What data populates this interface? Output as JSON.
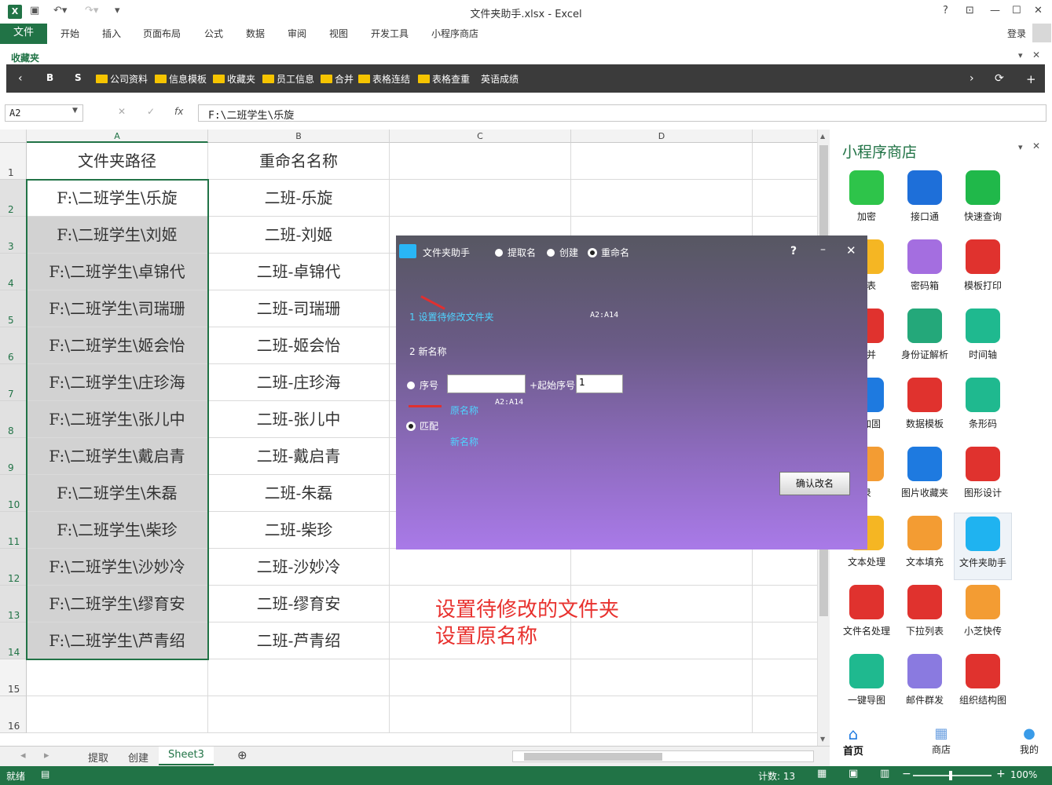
{
  "window": {
    "title": "文件夹助手.xlsx - Excel",
    "help": "?"
  },
  "ribbon": {
    "file_tab": "文件",
    "tabs": [
      "开始",
      "插入",
      "页面布局",
      "公式",
      "数据",
      "审阅",
      "视图",
      "开发工具",
      "小程序商店"
    ],
    "login": "登录"
  },
  "favorites": {
    "header": "收藏夹",
    "b_label": "B",
    "s_label": "S",
    "items": [
      "公司资料",
      "信息模板",
      "收藏夹",
      "员工信息",
      "合并",
      "表格连结",
      "表格查重",
      "英语成绩"
    ]
  },
  "formula_bar": {
    "name_box": "A2",
    "value": "F:\\二班学生\\乐旋"
  },
  "sheet": {
    "columns": [
      "A",
      "B",
      "C",
      "D"
    ],
    "rows": [
      "1",
      "2",
      "3",
      "4",
      "5",
      "6",
      "7",
      "8",
      "9",
      "10",
      "11",
      "12",
      "13",
      "14",
      "15",
      "16"
    ],
    "header_a": "文件夹路径",
    "header_b": "重命名名称",
    "col_a": [
      "F:\\二班学生\\乐旋",
      "F:\\二班学生\\刘姬",
      "F:\\二班学生\\卓锦代",
      "F:\\二班学生\\司瑞珊",
      "F:\\二班学生\\姬会怡",
      "F:\\二班学生\\庄珍海",
      "F:\\二班学生\\张儿中",
      "F:\\二班学生\\戴启青",
      "F:\\二班学生\\朱磊",
      "F:\\二班学生\\柴珍",
      "F:\\二班学生\\沙妙冷",
      "F:\\二班学生\\缪育安",
      "F:\\二班学生\\芦青绍"
    ],
    "col_b": [
      "二班-乐旋",
      "二班-刘姬",
      "二班-卓锦代",
      "二班-司瑞珊",
      "二班-姬会怡",
      "二班-庄珍海",
      "二班-张儿中",
      "二班-戴启青",
      "二班-朱磊",
      "二班-柴珍",
      "二班-沙妙冷",
      "二班-缪育安",
      "二班-芦青绍"
    ]
  },
  "sheet_tabs": [
    "提取",
    "创建",
    "Sheet3"
  ],
  "active_sheet": "Sheet3",
  "status": {
    "ready": "就绪",
    "count": "计数: 13",
    "zoom": "100%"
  },
  "dialog": {
    "title": "文件夹助手",
    "modes": [
      "提取名",
      "创建",
      "重命名"
    ],
    "selected_mode": "重命名",
    "step1": "1 设置待修改文件夹",
    "step1_range": "A2:A14",
    "step2": "2 新名称",
    "seq_label": "序号",
    "seq_input": "",
    "start_label": "+起始序号",
    "start_value": "1",
    "orig_label": "原名称",
    "orig_range": "A2:A14",
    "match_label": "匹配",
    "new_label": "新名称",
    "confirm": "确认改名"
  },
  "annotation": [
    "设置待修改的文件夹",
    "设置原名称"
  ],
  "store": {
    "title": "小程序商店",
    "apps": [
      {
        "label": "加密",
        "icon": "lock-icon",
        "color": "#2ec44a"
      },
      {
        "label": "接口通",
        "icon": "monitor-icon",
        "color": "#1e6fd9"
      },
      {
        "label": "快速查询",
        "icon": "search-icon",
        "color": "#20b84a"
      },
      {
        "label": "列表",
        "icon": "list-icon",
        "color": "#f5b623"
      },
      {
        "label": "密码箱",
        "icon": "key-icon",
        "color": "#a46ee0"
      },
      {
        "label": "模板打印",
        "icon": "printer-icon",
        "color": "#e0322e"
      },
      {
        "label": "合并",
        "icon": "merge-icon",
        "color": "#e0322e"
      },
      {
        "label": "身份证解析",
        "icon": "id-card-icon",
        "color": "#24a87a"
      },
      {
        "label": "时间轴",
        "icon": "timeline-icon",
        "color": "#1fb98f"
      },
      {
        "label": "号加固",
        "icon": "tablet-icon",
        "color": "#1e7ae0"
      },
      {
        "label": "数据模板",
        "icon": "network-icon",
        "color": "#e0322e"
      },
      {
        "label": "条形码",
        "icon": "barcode-icon",
        "color": "#1fb98f"
      },
      {
        "label": "录",
        "icon": "record-icon",
        "color": "#f39c33"
      },
      {
        "label": "图片收藏夹",
        "icon": "picture-icon",
        "color": "#1e7ae0"
      },
      {
        "label": "图形设计",
        "icon": "shapes-icon",
        "color": "#e0322e"
      },
      {
        "label": "文本处理",
        "icon": "text-icon",
        "color": "#f5b623"
      },
      {
        "label": "文本填充",
        "icon": "doc-icon",
        "color": "#f39c33"
      },
      {
        "label": "文件夹助手",
        "icon": "folder-icon",
        "color": "#1fb3f0"
      },
      {
        "label": "文件名处理",
        "icon": "files-icon",
        "color": "#e0322e"
      },
      {
        "label": "下拉列表",
        "icon": "dropdown-icon",
        "color": "#e0322e"
      },
      {
        "label": "小芝快传",
        "icon": "broadcast-icon",
        "color": "#f39c33"
      },
      {
        "label": "一键导图",
        "icon": "image-export-icon",
        "color": "#1fb98f"
      },
      {
        "label": "邮件群发",
        "icon": "mail-icon",
        "color": "#8a7ae0"
      },
      {
        "label": "组织结构图",
        "icon": "org-chart-icon",
        "color": "#e0322e"
      }
    ],
    "nav": [
      "首页",
      "商店",
      "我的"
    ]
  }
}
